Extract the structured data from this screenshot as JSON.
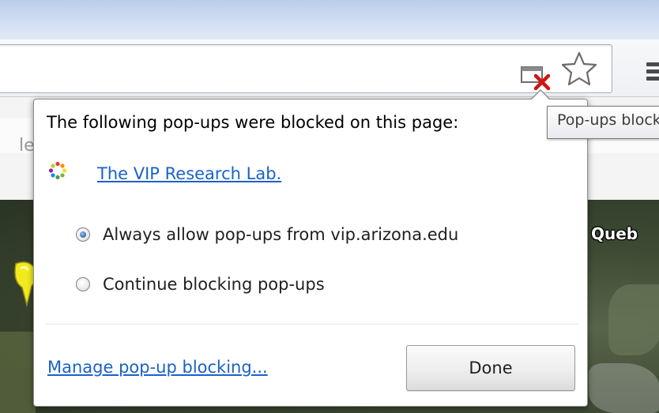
{
  "bubble": {
    "title": "The following pop-ups were blocked on this page:",
    "site_icon": "site-favicon-icon",
    "site_link": "The VIP Research Lab.",
    "options": [
      {
        "label": "Always allow pop-ups from vip.arizona.edu",
        "selected": true
      },
      {
        "label": "Continue blocking pop-ups",
        "selected": false
      }
    ],
    "manage_link": "Manage pop-up blocking...",
    "done_label": "Done"
  },
  "tooltip": {
    "text": "Pop-ups blocked"
  },
  "background_page": {
    "edge_text": "le",
    "map_label": "Queb"
  },
  "toolbar": {
    "popup_blocked_icon": "popup-blocked-icon",
    "bookmark_icon": "star-icon",
    "menu_icon": "menu-icon"
  },
  "colors": {
    "link": "#1a62c8",
    "blocked_x": "#d01515",
    "radio_checked": "#2e5e98"
  }
}
